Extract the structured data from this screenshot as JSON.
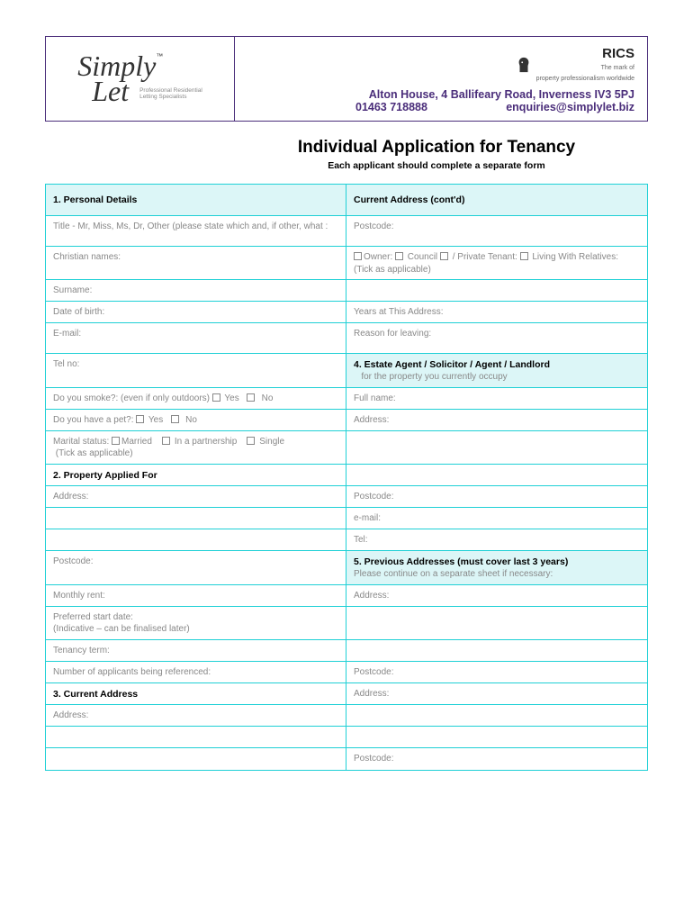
{
  "logo": {
    "line1": "Simply",
    "line2": "Let",
    "tm": "™",
    "tagline1": "Professional Residential",
    "tagline2": "Letting Specialists"
  },
  "rics": {
    "name": "RICS",
    "sub1": "The mark of",
    "sub2": "property professionalism worldwide"
  },
  "contact": {
    "address": "Alton House, 4 Ballifeary Road, Inverness IV3 5PJ",
    "phone": "01463 718888",
    "email": "enquiries@simplylet.biz"
  },
  "title": "Individual Application for Tenancy",
  "subtitle": "Each applicant should complete a separate form",
  "sections": {
    "s1": "1. Personal Details",
    "s1r": "Current Address (cont'd)",
    "title_label": "Title - Mr, Miss, Ms, Dr, Other (please state which and, if other, what :",
    "postcode": "Postcode:",
    "christian": "Christian names:",
    "tenure_owner": "Owner:",
    "tenure_council": "Council",
    "tenure_private": "/ Private Tenant:",
    "tenure_living": "Living With Relatives: (Tick as applicable)",
    "surname": "Surname:",
    "dob": "Date of birth:",
    "years_addr": "Years at This Address:",
    "email": "E-mail:",
    "reason": "Reason for leaving:",
    "tel": "Tel no:",
    "s4_title": "4. Estate Agent / Solicitor / Agent / Landlord",
    "s4_sub": "for the property you currently occupy",
    "smoke": "Do you smoke?: (even if only outdoors)",
    "yes": "Yes",
    "no": "No",
    "fullname": "Full name:",
    "pet": "Do you have a pet?:",
    "address": "Address:",
    "marital": "Marital status:",
    "married": "Married",
    "partnership": "In a partnership",
    "single": "Single",
    "tick": "(Tick as applicable)",
    "s2": "2. Property Applied For",
    "email2": "e-mail:",
    "tel2": "Tel:",
    "s5_title": "5. Previous Addresses  (must cover last 3 years)",
    "s5_sub": "Please continue on a separate sheet if necessary:",
    "monthly_rent": "Monthly rent:",
    "pref_start1": "Preferred start date:",
    "pref_start2": "(Indicative – can be finalised later)",
    "tenancy_term": "Tenancy term:",
    "num_applicants": "Number of applicants being referenced:",
    "s3": "3. Current Address"
  }
}
